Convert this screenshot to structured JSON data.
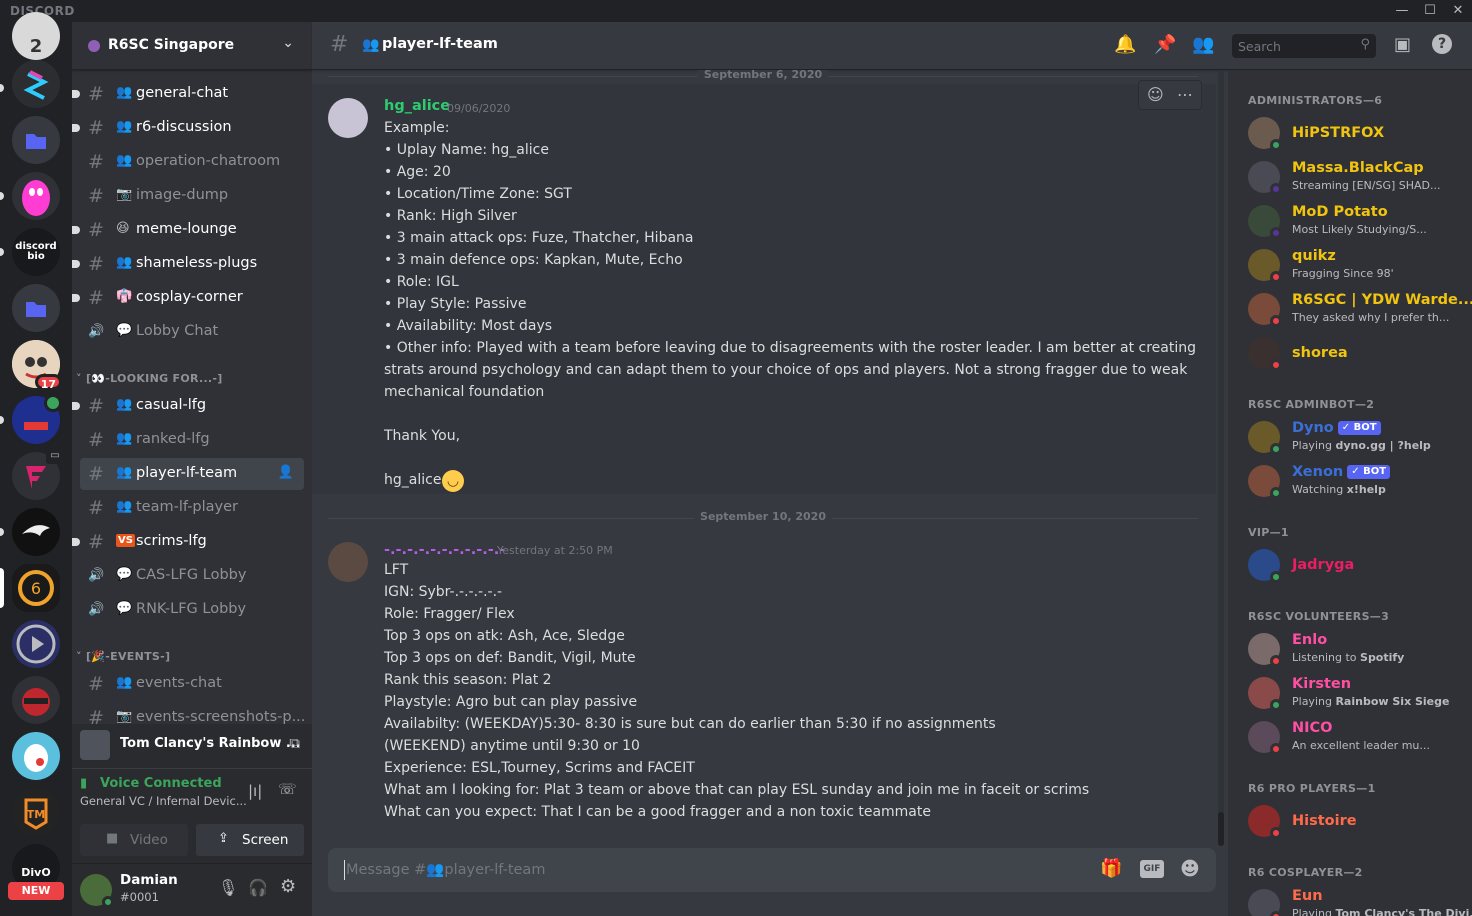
{
  "app": {
    "brand": "DISCORD"
  },
  "rail": {
    "top_badge": "2",
    "mention_badge": "17",
    "new_badge": "NEW",
    "divo_label": "DivO",
    "discord_bio_label": "discord bio"
  },
  "guild": {
    "name": "R6SC Singapore"
  },
  "channels": [
    {
      "name": "general-chat",
      "icon": "group-icon",
      "type": "text",
      "unread": true
    },
    {
      "name": "r6-discussion",
      "icon": "group-icon",
      "type": "text",
      "unread": true
    },
    {
      "name": "operation-chatroom",
      "icon": "group-icon",
      "type": "text",
      "unread": false
    },
    {
      "name": "image-dump",
      "icon": "camera-icon",
      "type": "text",
      "unread": false
    },
    {
      "name": "meme-lounge",
      "icon": "laugh-emoji-icon",
      "type": "text",
      "unread": true
    },
    {
      "name": "shameless-plugs",
      "icon": "group-icon",
      "type": "text",
      "unread": true
    },
    {
      "name": "cosplay-corner",
      "icon": "costume-icon",
      "type": "text",
      "unread": true
    },
    {
      "name": "Lobby Chat",
      "icon": "speech-icon",
      "type": "voice",
      "unread": false
    }
  ],
  "category_looking": "[👀-LOOKING FOR...-]",
  "channels_lf": [
    {
      "name": "casual-lfg",
      "icon": "group-icon",
      "type": "text",
      "unread": true
    },
    {
      "name": "ranked-lfg",
      "icon": "group-icon",
      "type": "text",
      "unread": false
    },
    {
      "name": "player-lf-team",
      "icon": "group-icon",
      "type": "text",
      "active": true
    },
    {
      "name": "team-lf-player",
      "icon": "group-icon",
      "type": "text",
      "unread": false
    },
    {
      "name": "scrims-lfg",
      "icon": "vs-icon",
      "type": "text",
      "unread": true
    },
    {
      "name": "CAS-LFG Lobby",
      "icon": "speech-icon",
      "type": "voice",
      "unread": false
    },
    {
      "name": "RNK-LFG Lobby",
      "icon": "speech-icon",
      "type": "voice",
      "unread": false
    }
  ],
  "category_events": "[🎉-EVENTS-]",
  "channels_events": [
    {
      "name": "events-chat",
      "icon": "group-icon",
      "type": "text"
    },
    {
      "name": "events-screenshots-p...",
      "icon": "camera-icon",
      "type": "text"
    }
  ],
  "activity": {
    "game": "Tom Clancy's Rainbow ..."
  },
  "voice": {
    "status": "Voice Connected",
    "location": "General VC / Infernal Devic...",
    "video_label": "Video",
    "screen_label": "Screen"
  },
  "user": {
    "name": "Damian",
    "tag": "#0001"
  },
  "header": {
    "channel": "player-lf-team",
    "search_placeholder": "Search"
  },
  "messages": [
    {
      "date_divider": "September 6, 2020",
      "author": "hg_alice",
      "author_color": "#2ecc71",
      "timestamp": "09/06/2020",
      "lines": [
        "Example:",
        "• Uplay Name: hg_alice",
        "• Age: 20",
        "• Location/Time Zone: SGT",
        "• Rank: High Silver",
        "• 3 main attack ops: Fuze, Thatcher, Hibana",
        "• 3 main defence ops: Kapkan, Mute, Echo",
        "• Role: IGL",
        "• Play Style: Passive",
        "• Availability: Most days",
        "• Other info: Played with a team before leaving due to disagreements with the roster leader. I am better at creating",
        "strats around psychology and can adapt them to your choice of ops and players. Not a strong fragger due to weak",
        "mechanical foundation",
        "",
        "Thank You,",
        "",
        "hg_alice"
      ]
    },
    {
      "date_divider": "September 10, 2020",
      "author": "-.-.-.-.-.-.-.-.-.-.-",
      "author_color": "#b45fe6",
      "timestamp": "Yesterday at 2:50 PM",
      "lines": [
        "LFT",
        "IGN: Sybr-.-.-.-.-.-",
        "Role: Fragger/ Flex",
        " Top 3 ops on atk: Ash, Ace, Sledge",
        "Top 3 ops on def: Bandit, Vigil, Mute",
        "Rank this season: Plat 2",
        "Playstyle: Agro but can play passive",
        "Availabilty: (WEEKDAY)5:30- 8:30 is sure but can do earlier than 5:30 if no assignments",
        "(WEEKEND) anytime until 9:30 or 10",
        "Experience: ESL,Tourney, Scrims and FACEIT",
        "What am I looking for: Plat 3 team or above that can play ESL sunday and join me in faceit or scrims",
        "What can you expect: That I can be a good fragger and a non toxic teammate"
      ]
    }
  ],
  "composer": {
    "placeholder": "Message #👥player-lf-team"
  },
  "member_groups": [
    {
      "title": "ADMINISTRATORS—6",
      "members": [
        {
          "name": "HiPSTRFOX",
          "color": "#f1c40f",
          "activity": "",
          "status": "#3ba55c"
        },
        {
          "name": "Massa.BlackCap",
          "color": "#f1c40f",
          "activity": "Streaming [EN/SG] SHAD...",
          "status": "#593695"
        },
        {
          "name": "MoD Potato",
          "color": "#f1c40f",
          "activity": "Most Likely Studying/S...",
          "status": "#593695"
        },
        {
          "name": "quikz",
          "color": "#f1c40f",
          "activity": "Fragging Since 98'",
          "status": "#ed4245"
        },
        {
          "name": "R6SGC | YDW Warde...",
          "color": "#f1c40f",
          "activity": "They asked why I prefer th...",
          "status": "#ed4245"
        },
        {
          "name": "shorea",
          "color": "#f1c40f",
          "activity": "",
          "status": "#ed4245"
        }
      ]
    },
    {
      "title": "R6SC ADMINBOT—2",
      "members": [
        {
          "name": "Dyno",
          "color": "#3b6fd8",
          "bot": "✓ BOT",
          "activity_prefix": "Playing ",
          "activity": "dyno.gg | ?help",
          "status": "#3ba55c"
        },
        {
          "name": "Xenon",
          "color": "#3b6fd8",
          "bot": "✓ BOT",
          "activity_prefix": "Watching ",
          "activity": "x!help",
          "status": "#3ba55c"
        }
      ]
    },
    {
      "title": "VIP—1",
      "members": [
        {
          "name": "Jadryga",
          "color": "#e91e63",
          "activity": "",
          "status": "#3ba55c"
        }
      ]
    },
    {
      "title": "R6SC VOLUNTEERS—3",
      "members": [
        {
          "name": "Enlo",
          "color": "#ff4fa3",
          "activity_prefix": "Listening to ",
          "activity": "Spotify",
          "status": "#ed4245"
        },
        {
          "name": "Kirsten",
          "color": "#ff4fa3",
          "activity_prefix": "Playing ",
          "activity": "Rainbow Six Siege",
          "status": "#3ba55c"
        },
        {
          "name": "NICO",
          "color": "#ff4fa3",
          "activity": "An excellent leader mu...",
          "status": "#ed4245"
        }
      ]
    },
    {
      "title": "R6 PRO PLAYERS—1",
      "members": [
        {
          "name": "Histoire",
          "color": "#ff6b4a",
          "activity": "",
          "status": "#ed4245"
        }
      ]
    },
    {
      "title": "R6 COSPLAYER—2",
      "members": [
        {
          "name": "Eun",
          "color": "#ff6b4a",
          "activity_prefix": "Playing ",
          "activity": "Tom Clancy's The Divi...",
          "status": "#ed4245"
        }
      ]
    }
  ]
}
